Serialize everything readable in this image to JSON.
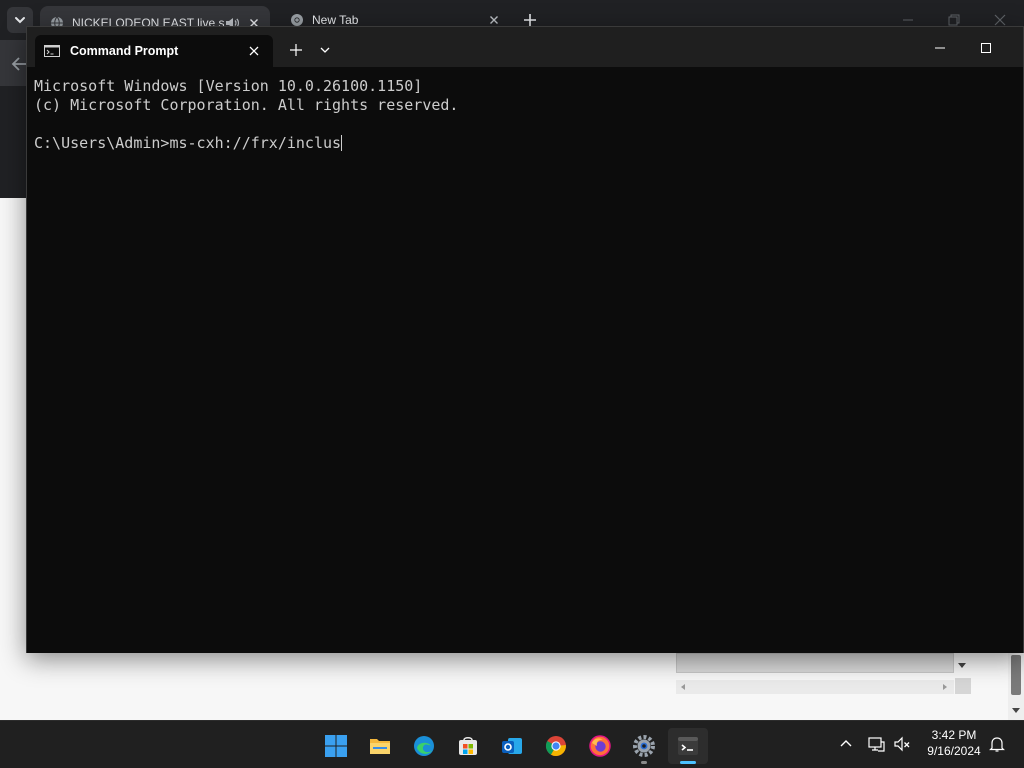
{
  "browser": {
    "tabs": [
      {
        "title": "NICKELODEON EAST live st",
        "active": true,
        "audio": true
      },
      {
        "title": "New Tab",
        "active": false
      }
    ]
  },
  "terminal": {
    "tab_title": "Command Prompt",
    "lines": [
      "Microsoft Windows [Version 10.0.26100.1150]",
      "(c) Microsoft Corporation. All rights reserved.",
      "",
      "C:\\Users\\Admin>ms-cxh://frx/inclus"
    ]
  },
  "taskbar": {
    "apps": [
      {
        "name": "start-button",
        "icon": "windows-logo-icon"
      },
      {
        "name": "file-explorer",
        "icon": "folder-icon"
      },
      {
        "name": "edge",
        "icon": "edge-icon"
      },
      {
        "name": "microsoft-store",
        "icon": "store-icon"
      },
      {
        "name": "outlook",
        "icon": "outlook-icon"
      },
      {
        "name": "chrome",
        "icon": "chrome-icon"
      },
      {
        "name": "firefox",
        "icon": "firefox-icon"
      },
      {
        "name": "settings",
        "icon": "gear-icon"
      },
      {
        "name": "terminal",
        "icon": "terminal-icon",
        "active": true
      }
    ],
    "tray": {
      "time": "3:42 PM",
      "date": "9/16/2024"
    }
  },
  "colors": {
    "terminal_bg": "#0c0c0c",
    "terminal_text": "#cccccc",
    "taskbar_bg": "#202020",
    "accent": "#4cc2ff"
  }
}
